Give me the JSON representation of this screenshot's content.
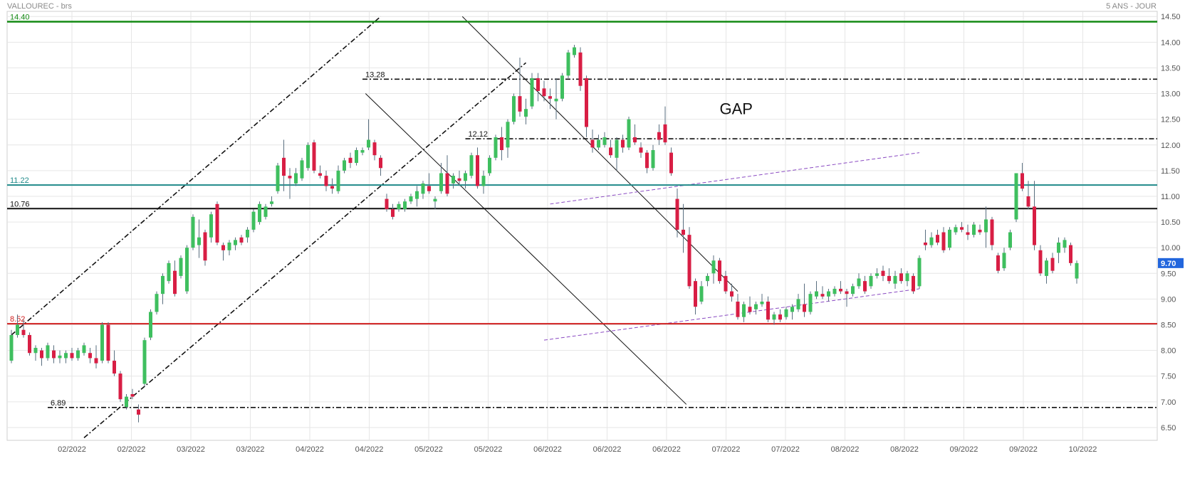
{
  "header": {
    "symbol_label": "VALLOUREC - brs",
    "period_label": "5 ANS - JOUR"
  },
  "colors": {
    "up": "#3fbf5f",
    "down": "#d81e44",
    "grid": "#e6e6e6",
    "price_tag_bg": "#2266dd",
    "level_14_40": "#138a13",
    "level_11_22": "#1f8a8a",
    "level_10_76": "#111111",
    "level_8_52": "#d02020",
    "channel": "#111111",
    "purple": "#8a4ac2"
  },
  "chart_data": {
    "type": "candlestick",
    "title": "VALLOUREC - brs",
    "subtitle": "5 ANS - JOUR",
    "ylim": [
      6.25,
      14.6
    ],
    "y_ticks": [
      6.5,
      7.0,
      7.5,
      8.0,
      8.5,
      9.0,
      9.5,
      10.0,
      10.5,
      11.0,
      11.5,
      12.0,
      12.5,
      13.0,
      13.5,
      14.0,
      14.5
    ],
    "y_tick_labels": [
      "6.50",
      "7.00",
      "7.50",
      "8.00",
      "8.50",
      "9.00",
      "9.50",
      "10.00",
      "10.50",
      "11.00",
      "11.50",
      "12.00",
      "12.50",
      "13.00",
      "13.50",
      "14.00",
      "14.50"
    ],
    "x_tick_labels": [
      "02/2022",
      "02/2022",
      "03/2022",
      "03/2022",
      "04/2022",
      "04/2022",
      "05/2022",
      "05/2022",
      "06/2022",
      "06/2022",
      "06/2022",
      "07/2022",
      "07/2022",
      "08/2022",
      "08/2022",
      "09/2022",
      "09/2022",
      "10/2022"
    ],
    "last_price": 9.7,
    "last_price_label": "9.70",
    "grid": true,
    "horizontal_levels": [
      {
        "value": 14.4,
        "label": "14.40",
        "style": "solid",
        "color_key": "level_14_40"
      },
      {
        "value": 11.22,
        "label": "11.22",
        "style": "solid",
        "color_key": "level_11_22"
      },
      {
        "value": 10.76,
        "label": "10.76",
        "style": "solid",
        "color_key": "level_10_76"
      },
      {
        "value": 8.52,
        "label": "8.52",
        "style": "solid",
        "color_key": "level_8_52"
      },
      {
        "value": 13.28,
        "label": "13.28",
        "style": "dashdot",
        "color_key": "channel",
        "from_index": 58
      },
      {
        "value": 12.12,
        "label": "12.12",
        "style": "dashdot",
        "color_key": "channel",
        "from_index": 75
      },
      {
        "value": 6.89,
        "label": "6.89",
        "style": "dashdot",
        "color_key": "channel",
        "from_index": 6
      }
    ],
    "annotations": [
      {
        "text": "GAP",
        "x_index": 117,
        "y": 12.6
      }
    ],
    "trendlines": [
      {
        "style": "dashdot",
        "color_key": "channel",
        "x1": 0,
        "y1": 8.3,
        "x2": 61,
        "y2": 14.5
      },
      {
        "style": "dashdot",
        "color_key": "channel",
        "x1": 12,
        "y1": 6.3,
        "x2": 85,
        "y2": 13.6
      },
      {
        "style": "solid",
        "color_key": "channel",
        "x1": 58.5,
        "y1": 13.0,
        "x2": 111.5,
        "y2": 6.95
      },
      {
        "style": "solid",
        "color_key": "channel",
        "x1": 74.5,
        "y1": 14.5,
        "x2": 120,
        "y2": 9.15
      },
      {
        "style": "dash",
        "color_key": "purple",
        "x1": 89,
        "y1": 10.85,
        "x2": 150,
        "y2": 11.85
      },
      {
        "style": "dash",
        "color_key": "purple",
        "x1": 88,
        "y1": 8.2,
        "x2": 150,
        "y2": 9.2
      }
    ],
    "candles": [
      {
        "o": 7.8,
        "h": 8.4,
        "l": 7.75,
        "c": 8.3
      },
      {
        "o": 8.3,
        "h": 8.7,
        "l": 8.25,
        "c": 8.5
      },
      {
        "o": 8.4,
        "h": 8.6,
        "l": 8.25,
        "c": 8.3
      },
      {
        "o": 8.3,
        "h": 8.35,
        "l": 7.9,
        "c": 7.95
      },
      {
        "o": 7.95,
        "h": 8.1,
        "l": 7.8,
        "c": 8.05
      },
      {
        "o": 8.0,
        "h": 8.05,
        "l": 7.7,
        "c": 7.85
      },
      {
        "o": 7.85,
        "h": 8.15,
        "l": 7.8,
        "c": 8.1
      },
      {
        "o": 8.0,
        "h": 8.1,
        "l": 7.75,
        "c": 7.85
      },
      {
        "o": 7.85,
        "h": 8.0,
        "l": 7.75,
        "c": 7.9
      },
      {
        "o": 7.85,
        "h": 8.0,
        "l": 7.75,
        "c": 7.95
      },
      {
        "o": 7.95,
        "h": 8.05,
        "l": 7.8,
        "c": 7.85
      },
      {
        "o": 7.85,
        "h": 8.05,
        "l": 7.8,
        "c": 8.0
      },
      {
        "o": 7.95,
        "h": 8.15,
        "l": 7.9,
        "c": 8.1
      },
      {
        "o": 7.95,
        "h": 8.05,
        "l": 7.75,
        "c": 7.85
      },
      {
        "o": 7.85,
        "h": 8.1,
        "l": 7.65,
        "c": 7.75
      },
      {
        "o": 7.8,
        "h": 8.55,
        "l": 7.75,
        "c": 8.5
      },
      {
        "o": 8.5,
        "h": 8.55,
        "l": 7.75,
        "c": 7.8
      },
      {
        "o": 7.8,
        "h": 8.0,
        "l": 7.5,
        "c": 7.55
      },
      {
        "o": 7.55,
        "h": 7.6,
        "l": 7.0,
        "c": 7.05
      },
      {
        "o": 6.9,
        "h": 7.15,
        "l": 6.85,
        "c": 7.1
      },
      {
        "o": 7.15,
        "h": 7.25,
        "l": 7.05,
        "c": 7.1
      },
      {
        "o": 6.85,
        "h": 6.95,
        "l": 6.6,
        "c": 6.75
      },
      {
        "o": 7.35,
        "h": 8.25,
        "l": 7.3,
        "c": 8.2
      },
      {
        "o": 8.25,
        "h": 8.8,
        "l": 8.2,
        "c": 8.75
      },
      {
        "o": 8.75,
        "h": 9.15,
        "l": 8.7,
        "c": 9.1
      },
      {
        "o": 9.1,
        "h": 9.5,
        "l": 8.9,
        "c": 9.45
      },
      {
        "o": 9.35,
        "h": 9.75,
        "l": 9.3,
        "c": 9.7
      },
      {
        "o": 9.55,
        "h": 9.75,
        "l": 9.05,
        "c": 9.1
      },
      {
        "o": 9.45,
        "h": 9.85,
        "l": 9.4,
        "c": 9.8
      },
      {
        "o": 9.15,
        "h": 10.05,
        "l": 9.1,
        "c": 10.0
      },
      {
        "o": 10.0,
        "h": 10.65,
        "l": 9.95,
        "c": 10.6
      },
      {
        "o": 10.05,
        "h": 10.55,
        "l": 9.8,
        "c": 10.2
      },
      {
        "o": 10.3,
        "h": 10.35,
        "l": 9.65,
        "c": 9.75
      },
      {
        "o": 10.2,
        "h": 10.7,
        "l": 10.1,
        "c": 10.65
      },
      {
        "o": 10.85,
        "h": 10.9,
        "l": 10.05,
        "c": 10.1
      },
      {
        "o": 10.05,
        "h": 10.1,
        "l": 9.75,
        "c": 9.95
      },
      {
        "o": 9.95,
        "h": 10.15,
        "l": 9.85,
        "c": 10.1
      },
      {
        "o": 10.05,
        "h": 10.2,
        "l": 9.95,
        "c": 10.15
      },
      {
        "o": 10.2,
        "h": 10.25,
        "l": 10.05,
        "c": 10.1
      },
      {
        "o": 10.2,
        "h": 10.4,
        "l": 10.1,
        "c": 10.35
      },
      {
        "o": 10.35,
        "h": 10.75,
        "l": 10.3,
        "c": 10.7
      },
      {
        "o": 10.5,
        "h": 10.9,
        "l": 10.45,
        "c": 10.85
      },
      {
        "o": 10.6,
        "h": 10.85,
        "l": 10.55,
        "c": 10.8
      },
      {
        "o": 10.85,
        "h": 11.0,
        "l": 10.8,
        "c": 10.9
      },
      {
        "o": 11.1,
        "h": 11.65,
        "l": 11.05,
        "c": 11.6
      },
      {
        "o": 11.75,
        "h": 12.1,
        "l": 11.1,
        "c": 11.4
      },
      {
        "o": 11.4,
        "h": 11.55,
        "l": 10.95,
        "c": 11.35
      },
      {
        "o": 11.25,
        "h": 11.55,
        "l": 11.2,
        "c": 11.45
      },
      {
        "o": 11.35,
        "h": 11.75,
        "l": 11.3,
        "c": 11.7
      },
      {
        "o": 11.55,
        "h": 12.05,
        "l": 11.5,
        "c": 12.0
      },
      {
        "o": 12.05,
        "h": 12.1,
        "l": 11.45,
        "c": 11.5
      },
      {
        "o": 11.45,
        "h": 11.6,
        "l": 11.35,
        "c": 11.4
      },
      {
        "o": 11.4,
        "h": 11.5,
        "l": 11.1,
        "c": 11.2
      },
      {
        "o": 11.2,
        "h": 11.35,
        "l": 11.05,
        "c": 11.15
      },
      {
        "o": 11.1,
        "h": 11.6,
        "l": 11.05,
        "c": 11.5
      },
      {
        "o": 11.5,
        "h": 11.75,
        "l": 11.45,
        "c": 11.7
      },
      {
        "o": 11.75,
        "h": 11.85,
        "l": 11.55,
        "c": 11.65
      },
      {
        "o": 11.65,
        "h": 11.95,
        "l": 11.6,
        "c": 11.9
      },
      {
        "o": 11.85,
        "h": 11.95,
        "l": 11.8,
        "c": 11.9
      },
      {
        "o": 11.95,
        "h": 12.5,
        "l": 11.9,
        "c": 12.1
      },
      {
        "o": 12.05,
        "h": 12.1,
        "l": 11.7,
        "c": 11.8
      },
      {
        "o": 11.75,
        "h": 11.8,
        "l": 11.4,
        "c": 11.55
      },
      {
        "o": 10.95,
        "h": 11.05,
        "l": 10.7,
        "c": 10.75
      },
      {
        "o": 10.75,
        "h": 10.85,
        "l": 10.55,
        "c": 10.6
      },
      {
        "o": 10.75,
        "h": 10.9,
        "l": 10.7,
        "c": 10.85
      },
      {
        "o": 10.75,
        "h": 10.95,
        "l": 10.7,
        "c": 10.9
      },
      {
        "o": 10.9,
        "h": 11.05,
        "l": 10.85,
        "c": 11.0
      },
      {
        "o": 10.95,
        "h": 11.2,
        "l": 10.8,
        "c": 11.1
      },
      {
        "o": 11.05,
        "h": 11.3,
        "l": 10.95,
        "c": 11.25
      },
      {
        "o": 11.2,
        "h": 11.45,
        "l": 11.05,
        "c": 11.1
      },
      {
        "o": 10.9,
        "h": 11.0,
        "l": 10.75,
        "c": 10.95
      },
      {
        "o": 11.1,
        "h": 11.65,
        "l": 11.05,
        "c": 11.45
      },
      {
        "o": 11.45,
        "h": 11.8,
        "l": 11.0,
        "c": 11.05
      },
      {
        "o": 11.25,
        "h": 11.45,
        "l": 11.15,
        "c": 11.4
      },
      {
        "o": 11.35,
        "h": 11.5,
        "l": 11.2,
        "c": 11.3
      },
      {
        "o": 11.3,
        "h": 11.5,
        "l": 11.15,
        "c": 11.45
      },
      {
        "o": 11.4,
        "h": 11.85,
        "l": 11.35,
        "c": 11.8
      },
      {
        "o": 11.8,
        "h": 11.95,
        "l": 11.15,
        "c": 11.2
      },
      {
        "o": 11.2,
        "h": 11.5,
        "l": 11.05,
        "c": 11.4
      },
      {
        "o": 11.45,
        "h": 11.8,
        "l": 11.4,
        "c": 11.75
      },
      {
        "o": 11.75,
        "h": 12.2,
        "l": 11.7,
        "c": 12.15
      },
      {
        "o": 12.15,
        "h": 12.35,
        "l": 11.7,
        "c": 11.9
      },
      {
        "o": 11.95,
        "h": 12.5,
        "l": 11.75,
        "c": 12.45
      },
      {
        "o": 12.45,
        "h": 13.0,
        "l": 12.4,
        "c": 12.95
      },
      {
        "o": 12.95,
        "h": 13.7,
        "l": 12.55,
        "c": 12.65
      },
      {
        "o": 12.55,
        "h": 12.9,
        "l": 12.4,
        "c": 12.7
      },
      {
        "o": 12.75,
        "h": 13.4,
        "l": 12.7,
        "c": 13.3
      },
      {
        "o": 13.3,
        "h": 13.4,
        "l": 12.85,
        "c": 13.05
      },
      {
        "o": 13.1,
        "h": 13.25,
        "l": 12.85,
        "c": 12.95
      },
      {
        "o": 12.95,
        "h": 13.1,
        "l": 12.7,
        "c": 12.9
      },
      {
        "o": 12.85,
        "h": 13.3,
        "l": 12.5,
        "c": 12.9
      },
      {
        "o": 12.9,
        "h": 13.4,
        "l": 12.85,
        "c": 13.35
      },
      {
        "o": 13.35,
        "h": 13.85,
        "l": 13.3,
        "c": 13.8
      },
      {
        "o": 13.75,
        "h": 13.95,
        "l": 13.7,
        "c": 13.9
      },
      {
        "o": 13.8,
        "h": 13.9,
        "l": 13.05,
        "c": 13.15
      },
      {
        "o": 13.3,
        "h": 13.35,
        "l": 12.15,
        "c": 12.35
      },
      {
        "o": 12.1,
        "h": 12.3,
        "l": 11.85,
        "c": 11.95
      },
      {
        "o": 11.95,
        "h": 12.2,
        "l": 11.9,
        "c": 12.1
      },
      {
        "o": 12.0,
        "h": 12.25,
        "l": 11.95,
        "c": 12.15
      },
      {
        "o": 11.95,
        "h": 12.1,
        "l": 11.75,
        "c": 11.8
      },
      {
        "o": 11.75,
        "h": 12.15,
        "l": 11.5,
        "c": 12.1
      },
      {
        "o": 12.1,
        "h": 12.2,
        "l": 11.85,
        "c": 11.95
      },
      {
        "o": 11.95,
        "h": 12.55,
        "l": 11.9,
        "c": 12.5
      },
      {
        "o": 12.15,
        "h": 12.4,
        "l": 12.0,
        "c": 12.05
      },
      {
        "o": 11.95,
        "h": 12.05,
        "l": 11.75,
        "c": 11.85
      },
      {
        "o": 11.85,
        "h": 11.9,
        "l": 11.45,
        "c": 11.55
      },
      {
        "o": 11.55,
        "h": 12.0,
        "l": 11.5,
        "c": 11.9
      },
      {
        "o": 12.25,
        "h": 12.4,
        "l": 12.0,
        "c": 12.1
      },
      {
        "o": 12.4,
        "h": 12.75,
        "l": 12.0,
        "c": 12.05
      },
      {
        "o": 11.85,
        "h": 11.95,
        "l": 11.4,
        "c": 11.45
      },
      {
        "o": 10.95,
        "h": 11.15,
        "l": 10.2,
        "c": 10.35
      },
      {
        "o": 10.35,
        "h": 10.85,
        "l": 9.9,
        "c": 10.25
      },
      {
        "o": 10.25,
        "h": 10.4,
        "l": 9.2,
        "c": 9.25
      },
      {
        "o": 9.35,
        "h": 9.4,
        "l": 8.7,
        "c": 8.85
      },
      {
        "o": 8.95,
        "h": 9.35,
        "l": 8.9,
        "c": 9.25
      },
      {
        "o": 9.35,
        "h": 9.5,
        "l": 9.25,
        "c": 9.45
      },
      {
        "o": 9.5,
        "h": 9.85,
        "l": 9.3,
        "c": 9.75
      },
      {
        "o": 9.75,
        "h": 9.8,
        "l": 9.3,
        "c": 9.35
      },
      {
        "o": 9.45,
        "h": 9.55,
        "l": 9.1,
        "c": 9.15
      },
      {
        "o": 9.15,
        "h": 9.3,
        "l": 8.95,
        "c": 9.05
      },
      {
        "o": 8.95,
        "h": 9.1,
        "l": 8.6,
        "c": 8.65
      },
      {
        "o": 8.65,
        "h": 8.95,
        "l": 8.55,
        "c": 8.9
      },
      {
        "o": 8.85,
        "h": 9.05,
        "l": 8.7,
        "c": 8.75
      },
      {
        "o": 8.8,
        "h": 8.95,
        "l": 8.7,
        "c": 8.9
      },
      {
        "o": 8.9,
        "h": 9.1,
        "l": 8.85,
        "c": 8.95
      },
      {
        "o": 8.95,
        "h": 9.05,
        "l": 8.55,
        "c": 8.6
      },
      {
        "o": 8.6,
        "h": 8.75,
        "l": 8.5,
        "c": 8.7
      },
      {
        "o": 8.7,
        "h": 8.8,
        "l": 8.55,
        "c": 8.6
      },
      {
        "o": 8.65,
        "h": 8.85,
        "l": 8.6,
        "c": 8.8
      },
      {
        "o": 8.75,
        "h": 8.9,
        "l": 8.6,
        "c": 8.85
      },
      {
        "o": 8.8,
        "h": 9.1,
        "l": 8.75,
        "c": 9.0
      },
      {
        "o": 8.9,
        "h": 9.3,
        "l": 8.65,
        "c": 8.75
      },
      {
        "o": 8.75,
        "h": 9.15,
        "l": 8.7,
        "c": 9.1
      },
      {
        "o": 9.05,
        "h": 9.35,
        "l": 9.0,
        "c": 9.15
      },
      {
        "o": 9.1,
        "h": 9.25,
        "l": 9.0,
        "c": 9.05
      },
      {
        "o": 9.05,
        "h": 9.2,
        "l": 8.95,
        "c": 9.15
      },
      {
        "o": 9.1,
        "h": 9.25,
        "l": 9.05,
        "c": 9.2
      },
      {
        "o": 9.2,
        "h": 9.35,
        "l": 9.1,
        "c": 9.15
      },
      {
        "o": 9.15,
        "h": 9.2,
        "l": 8.85,
        "c": 9.1
      },
      {
        "o": 9.1,
        "h": 9.3,
        "l": 9.05,
        "c": 9.25
      },
      {
        "o": 9.25,
        "h": 9.5,
        "l": 9.2,
        "c": 9.4
      },
      {
        "o": 9.35,
        "h": 9.45,
        "l": 9.1,
        "c": 9.15
      },
      {
        "o": 9.25,
        "h": 9.5,
        "l": 9.2,
        "c": 9.45
      },
      {
        "o": 9.45,
        "h": 9.6,
        "l": 9.4,
        "c": 9.5
      },
      {
        "o": 9.55,
        "h": 9.65,
        "l": 9.35,
        "c": 9.45
      },
      {
        "o": 9.45,
        "h": 9.6,
        "l": 9.3,
        "c": 9.35
      },
      {
        "o": 9.3,
        "h": 9.55,
        "l": 9.2,
        "c": 9.45
      },
      {
        "o": 9.5,
        "h": 9.6,
        "l": 9.3,
        "c": 9.35
      },
      {
        "o": 9.35,
        "h": 9.55,
        "l": 9.25,
        "c": 9.5
      },
      {
        "o": 9.45,
        "h": 9.5,
        "l": 9.1,
        "c": 9.15
      },
      {
        "o": 9.25,
        "h": 9.85,
        "l": 9.2,
        "c": 9.8
      },
      {
        "o": 10.1,
        "h": 10.35,
        "l": 9.95,
        "c": 10.05
      },
      {
        "o": 10.05,
        "h": 10.3,
        "l": 10.0,
        "c": 10.2
      },
      {
        "o": 10.25,
        "h": 10.35,
        "l": 10.05,
        "c": 10.1
      },
      {
        "o": 10.3,
        "h": 10.4,
        "l": 9.9,
        "c": 9.95
      },
      {
        "o": 10.0,
        "h": 10.4,
        "l": 9.95,
        "c": 10.35
      },
      {
        "o": 10.3,
        "h": 10.45,
        "l": 10.25,
        "c": 10.4
      },
      {
        "o": 10.4,
        "h": 10.5,
        "l": 10.3,
        "c": 10.35
      },
      {
        "o": 10.3,
        "h": 10.45,
        "l": 10.15,
        "c": 10.25
      },
      {
        "o": 10.25,
        "h": 10.5,
        "l": 10.2,
        "c": 10.45
      },
      {
        "o": 10.35,
        "h": 10.45,
        "l": 10.25,
        "c": 10.3
      },
      {
        "o": 10.3,
        "h": 10.8,
        "l": 10.0,
        "c": 10.55
      },
      {
        "o": 10.55,
        "h": 10.6,
        "l": 9.95,
        "c": 10.05
      },
      {
        "o": 9.85,
        "h": 9.9,
        "l": 9.5,
        "c": 9.55
      },
      {
        "o": 9.6,
        "h": 10.0,
        "l": 9.55,
        "c": 9.9
      },
      {
        "o": 10.0,
        "h": 10.35,
        "l": 9.95,
        "c": 10.3
      },
      {
        "o": 10.55,
        "h": 11.45,
        "l": 10.5,
        "c": 11.45
      },
      {
        "o": 11.45,
        "h": 11.65,
        "l": 11.1,
        "c": 11.15
      },
      {
        "o": 11.0,
        "h": 11.3,
        "l": 10.75,
        "c": 10.8
      },
      {
        "o": 10.8,
        "h": 11.3,
        "l": 9.95,
        "c": 10.05
      },
      {
        "o": 9.95,
        "h": 10.05,
        "l": 9.45,
        "c": 9.5
      },
      {
        "o": 9.45,
        "h": 9.8,
        "l": 9.3,
        "c": 9.75
      },
      {
        "o": 9.8,
        "h": 9.9,
        "l": 9.5,
        "c": 9.55
      },
      {
        "o": 9.9,
        "h": 10.2,
        "l": 9.7,
        "c": 10.1
      },
      {
        "o": 10.0,
        "h": 10.2,
        "l": 9.9,
        "c": 10.15
      },
      {
        "o": 10.05,
        "h": 10.1,
        "l": 9.65,
        "c": 9.7
      },
      {
        "o": 9.4,
        "h": 9.75,
        "l": 9.3,
        "c": 9.7
      }
    ]
  }
}
